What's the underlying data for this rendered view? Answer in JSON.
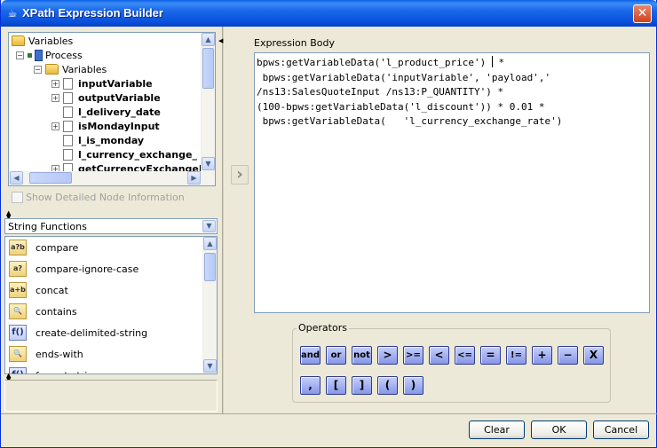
{
  "window": {
    "title": "XPath Expression Builder",
    "close_label": "✕"
  },
  "tree": {
    "items": [
      {
        "label": "Variables",
        "level": 0,
        "icon": "folder-icon",
        "bold": false
      },
      {
        "label": "Process",
        "level": 1,
        "icon": "process-icon",
        "bold": false
      },
      {
        "label": "Variables",
        "level": 2,
        "icon": "folder-icon",
        "bold": false
      },
      {
        "label": "inputVariable",
        "level": 3,
        "icon": "document-icon",
        "bold": true
      },
      {
        "label": "outputVariable",
        "level": 3,
        "icon": "document-icon",
        "bold": true
      },
      {
        "label": "l_delivery_date",
        "level": 3,
        "icon": "document-icon",
        "bold": true
      },
      {
        "label": "isMondayInput",
        "level": 3,
        "icon": "document-icon",
        "bold": true
      },
      {
        "label": "l_is_monday",
        "level": 3,
        "icon": "document-icon",
        "bold": true
      },
      {
        "label": "l_currency_exchange_",
        "level": 3,
        "icon": "document-icon",
        "bold": true
      },
      {
        "label": "getCurrencyExchangeR",
        "level": 3,
        "icon": "document-icon",
        "bold": true
      }
    ]
  },
  "show_detail": {
    "label": "Show Detailed Node Information",
    "checked": false
  },
  "function_category": {
    "selected": "String Functions"
  },
  "functions": [
    {
      "label": "compare",
      "icon": "compare-icon",
      "glyph": "a?b"
    },
    {
      "label": "compare-ignore-case",
      "icon": "compare-ignore-case-icon",
      "glyph": "a?"
    },
    {
      "label": "concat",
      "icon": "concat-icon",
      "glyph": "a+b"
    },
    {
      "label": "contains",
      "icon": "contains-icon",
      "glyph": "🔍"
    },
    {
      "label": "create-delimited-string",
      "icon": "function-icon",
      "glyph": "f()"
    },
    {
      "label": "ends-with",
      "icon": "ends-with-icon",
      "glyph": "🔍"
    },
    {
      "label": "format-string",
      "icon": "function-icon",
      "glyph": "f()"
    }
  ],
  "expression": {
    "label": "Expression Body",
    "lines": [
      "bpws:getVariableData('l_product_price') ",
      " bpws:getVariableData('inputVariable', 'payload','",
      "/ns13:SalesQuoteInput /ns13:P_QUANTITY') *",
      "(100-bpws:getVariableData('l_discount')) * 0.01 *",
      " bpws:getVariableData(   'l_currency_exchange_rate')"
    ],
    "line1_suffix": " *"
  },
  "operators": {
    "label": "Operators",
    "row1": [
      "and",
      "or",
      "not",
      ">",
      ">=",
      "<",
      "<=",
      "=",
      "!=",
      "+",
      "−",
      "X"
    ],
    "row2": [
      ",",
      "[",
      "]",
      "(",
      ")"
    ]
  },
  "buttons": {
    "clear": "Clear",
    "ok": "OK",
    "cancel": "Cancel"
  }
}
